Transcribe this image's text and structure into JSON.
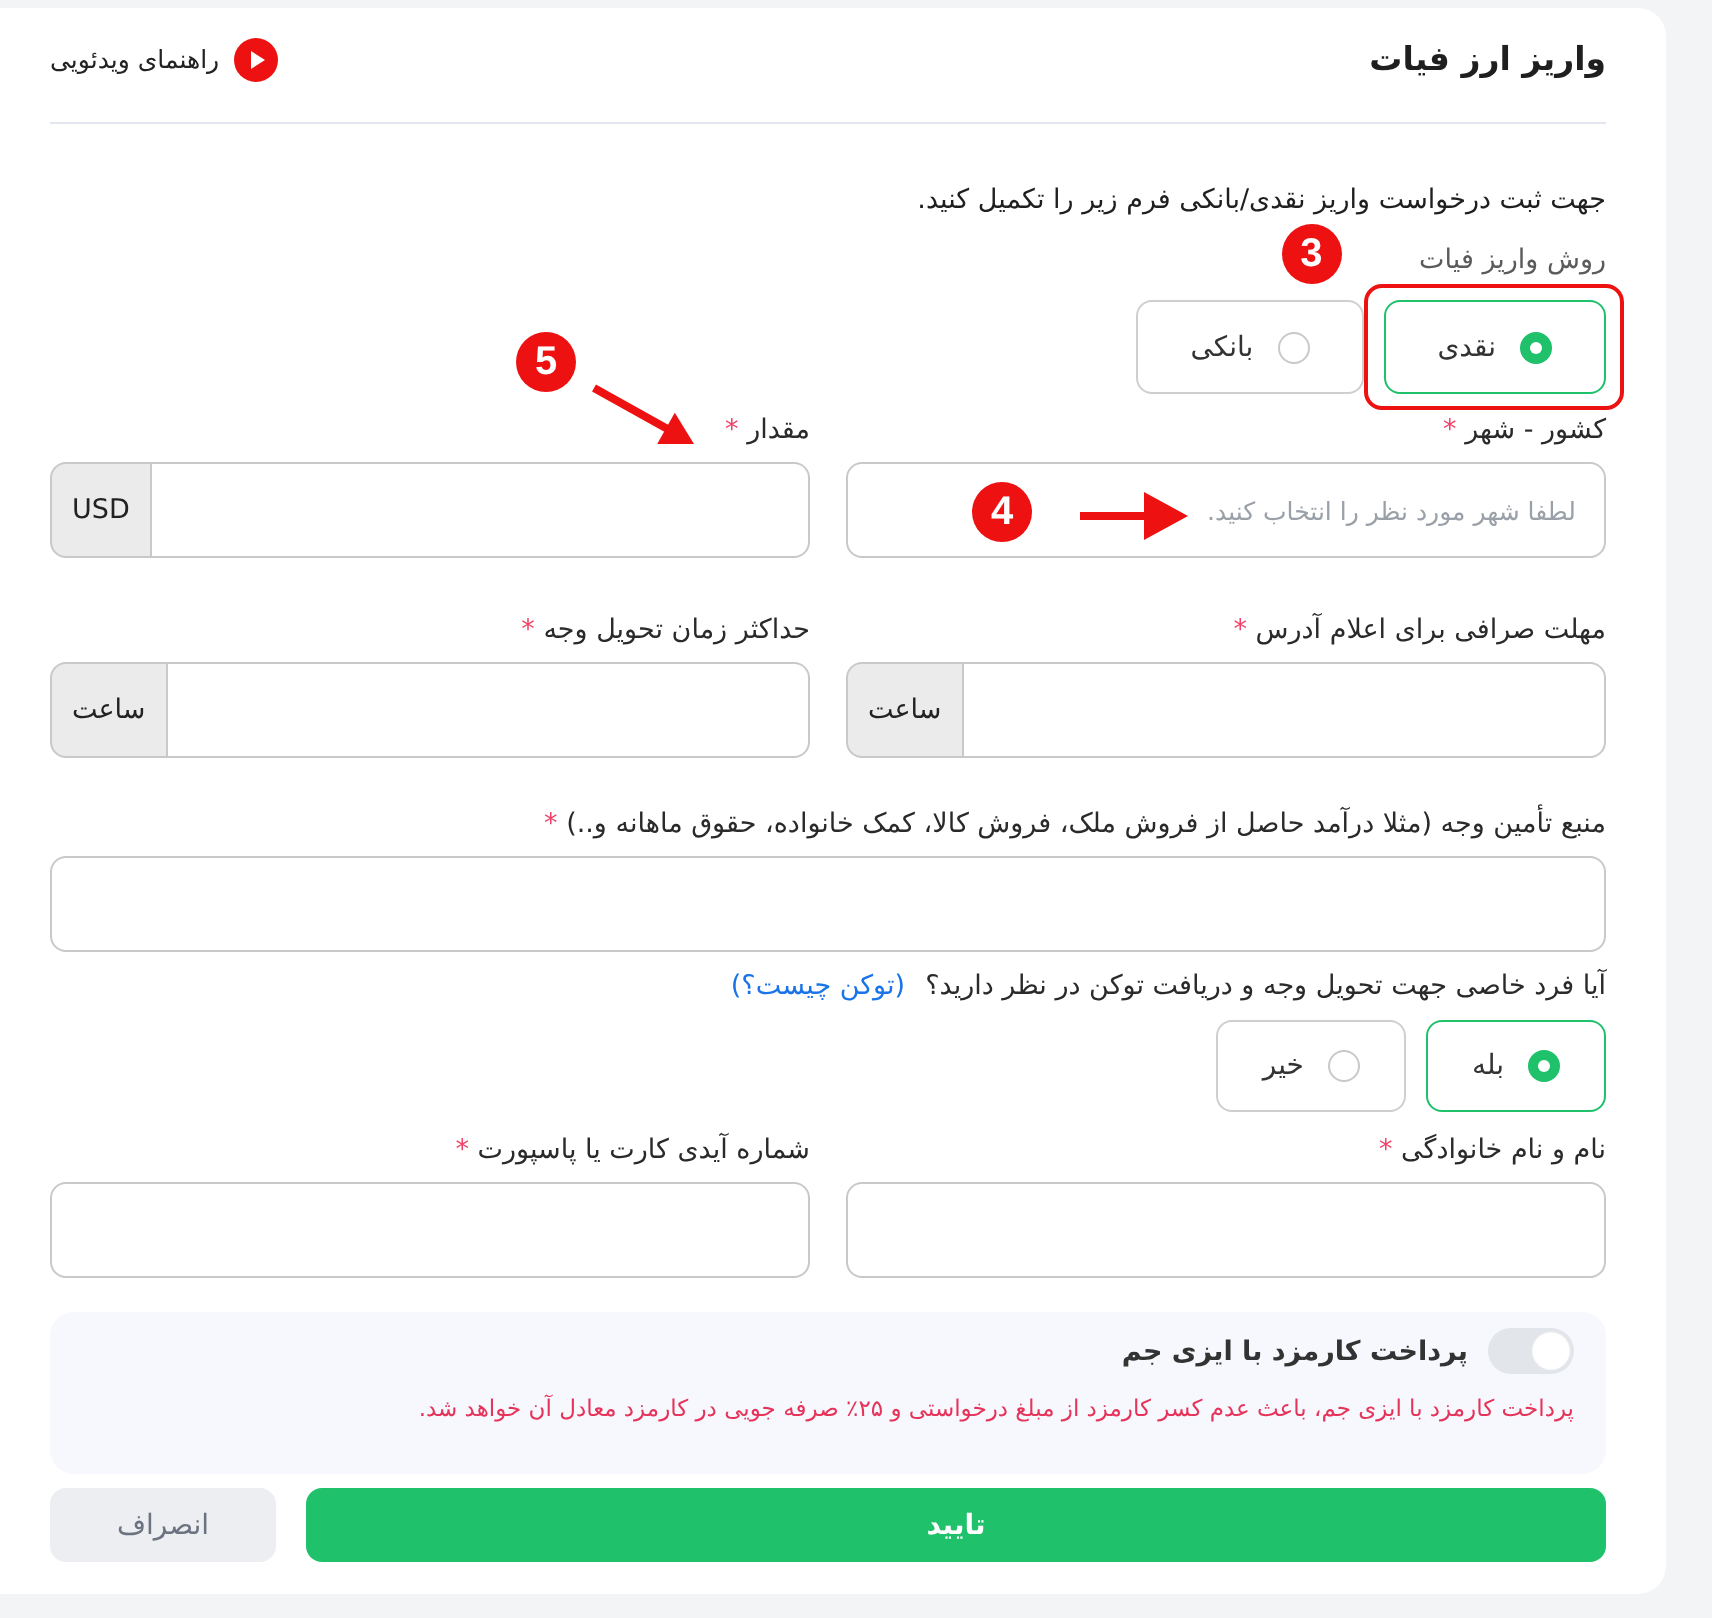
{
  "header": {
    "title": "واریز ارز فیات",
    "video_guide": "راهنمای ویدئویی"
  },
  "form": {
    "intro": "جهت ثبت درخواست واریز نقدی/بانکی فرم زیر را تکمیل کنید.",
    "method": {
      "label": "روش واریز فیات",
      "options": [
        {
          "label": "نقدی",
          "selected": true
        },
        {
          "label": "بانکی",
          "selected": false
        }
      ],
      "annotation": {
        "number": "3",
        "kind": "frame"
      }
    },
    "field_rows": [
      [
        {
          "label": "کشور - شهر",
          "required_mark": "*",
          "placeholder": "لطفا شهر مورد نظر را انتخاب کنید.",
          "annotation": {
            "number": "4",
            "kind": "arrow"
          }
        },
        {
          "label": "مقدار",
          "required_mark": "*",
          "addon": "USD",
          "annotation": {
            "number": "5",
            "kind": "label_arrow"
          }
        }
      ],
      [
        {
          "label": "مهلت صرافی برای اعلام آدرس",
          "required_mark": "*",
          "addon": "ساعت"
        },
        {
          "label": "حداکثر زمان تحویل وجه",
          "required_mark": "*",
          "addon": "ساعت"
        }
      ],
      [
        {
          "label": "منبع تأمین وجه (مثلا درآمد حاصل از فروش ملک، فروش کالا، کمک خانواده، حقوق ماهانه و..)",
          "required_mark": "*"
        }
      ]
    ],
    "token": {
      "question": "آیا فرد خاصی جهت تحویل وجه و دریافت توکن در نظر دارید؟",
      "link": "(توکن چیست؟)",
      "options": [
        {
          "label": "بله",
          "selected": true
        },
        {
          "label": "خیر",
          "selected": false
        }
      ]
    },
    "identity_fields": [
      {
        "label": "نام و نام خانوادگی",
        "required_mark": "*"
      },
      {
        "label": "شماره آیدی کارت یا پاسپورت",
        "required_mark": "*"
      }
    ],
    "fee": {
      "title": "پرداخت کارمزد با ایزی جم",
      "on": false,
      "note": "پرداخت کارمزد با ایزی جم، باعث عدم کسر کارمزد از مبلغ درخواستی و ۲۵٪ صرفه جویی در کارمزد معادل آن خواهد شد."
    },
    "buttons": [
      {
        "label": "تایید",
        "kind": "primary"
      },
      {
        "label": "انصراف",
        "kind": "secondary"
      }
    ]
  }
}
